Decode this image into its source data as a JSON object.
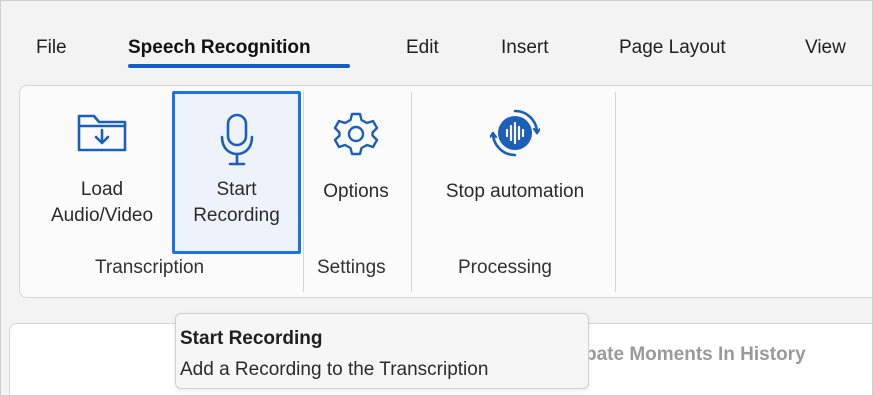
{
  "menu": {
    "file": "File",
    "speech_recognition": "Speech Recognition",
    "edit": "Edit",
    "insert": "Insert",
    "page_layout": "Page Layout",
    "view": "View"
  },
  "ribbon": {
    "load_label_line1": "Load",
    "load_label_line2": "Audio/Video",
    "start_label_line1": "Start",
    "start_label_line2": "Recording",
    "options_label": "Options",
    "stop_label": "Stop automation",
    "groups": {
      "transcription": "Transcription",
      "settings": "Settings",
      "processing": "Processing"
    }
  },
  "tooltip": {
    "title": "Start Recording",
    "description": "Add a Recording to the Transcription"
  },
  "document": {
    "title_fragment": "bate Moments In History"
  },
  "colors": {
    "accent": "#0f5fc6",
    "selection_border": "#1a73e8",
    "icon_blue": "#1c5fb8"
  },
  "icons": {
    "load": "folder-download-icon",
    "start": "microphone-icon",
    "options": "gear-icon",
    "stop": "audio-wave-circle-icon"
  }
}
